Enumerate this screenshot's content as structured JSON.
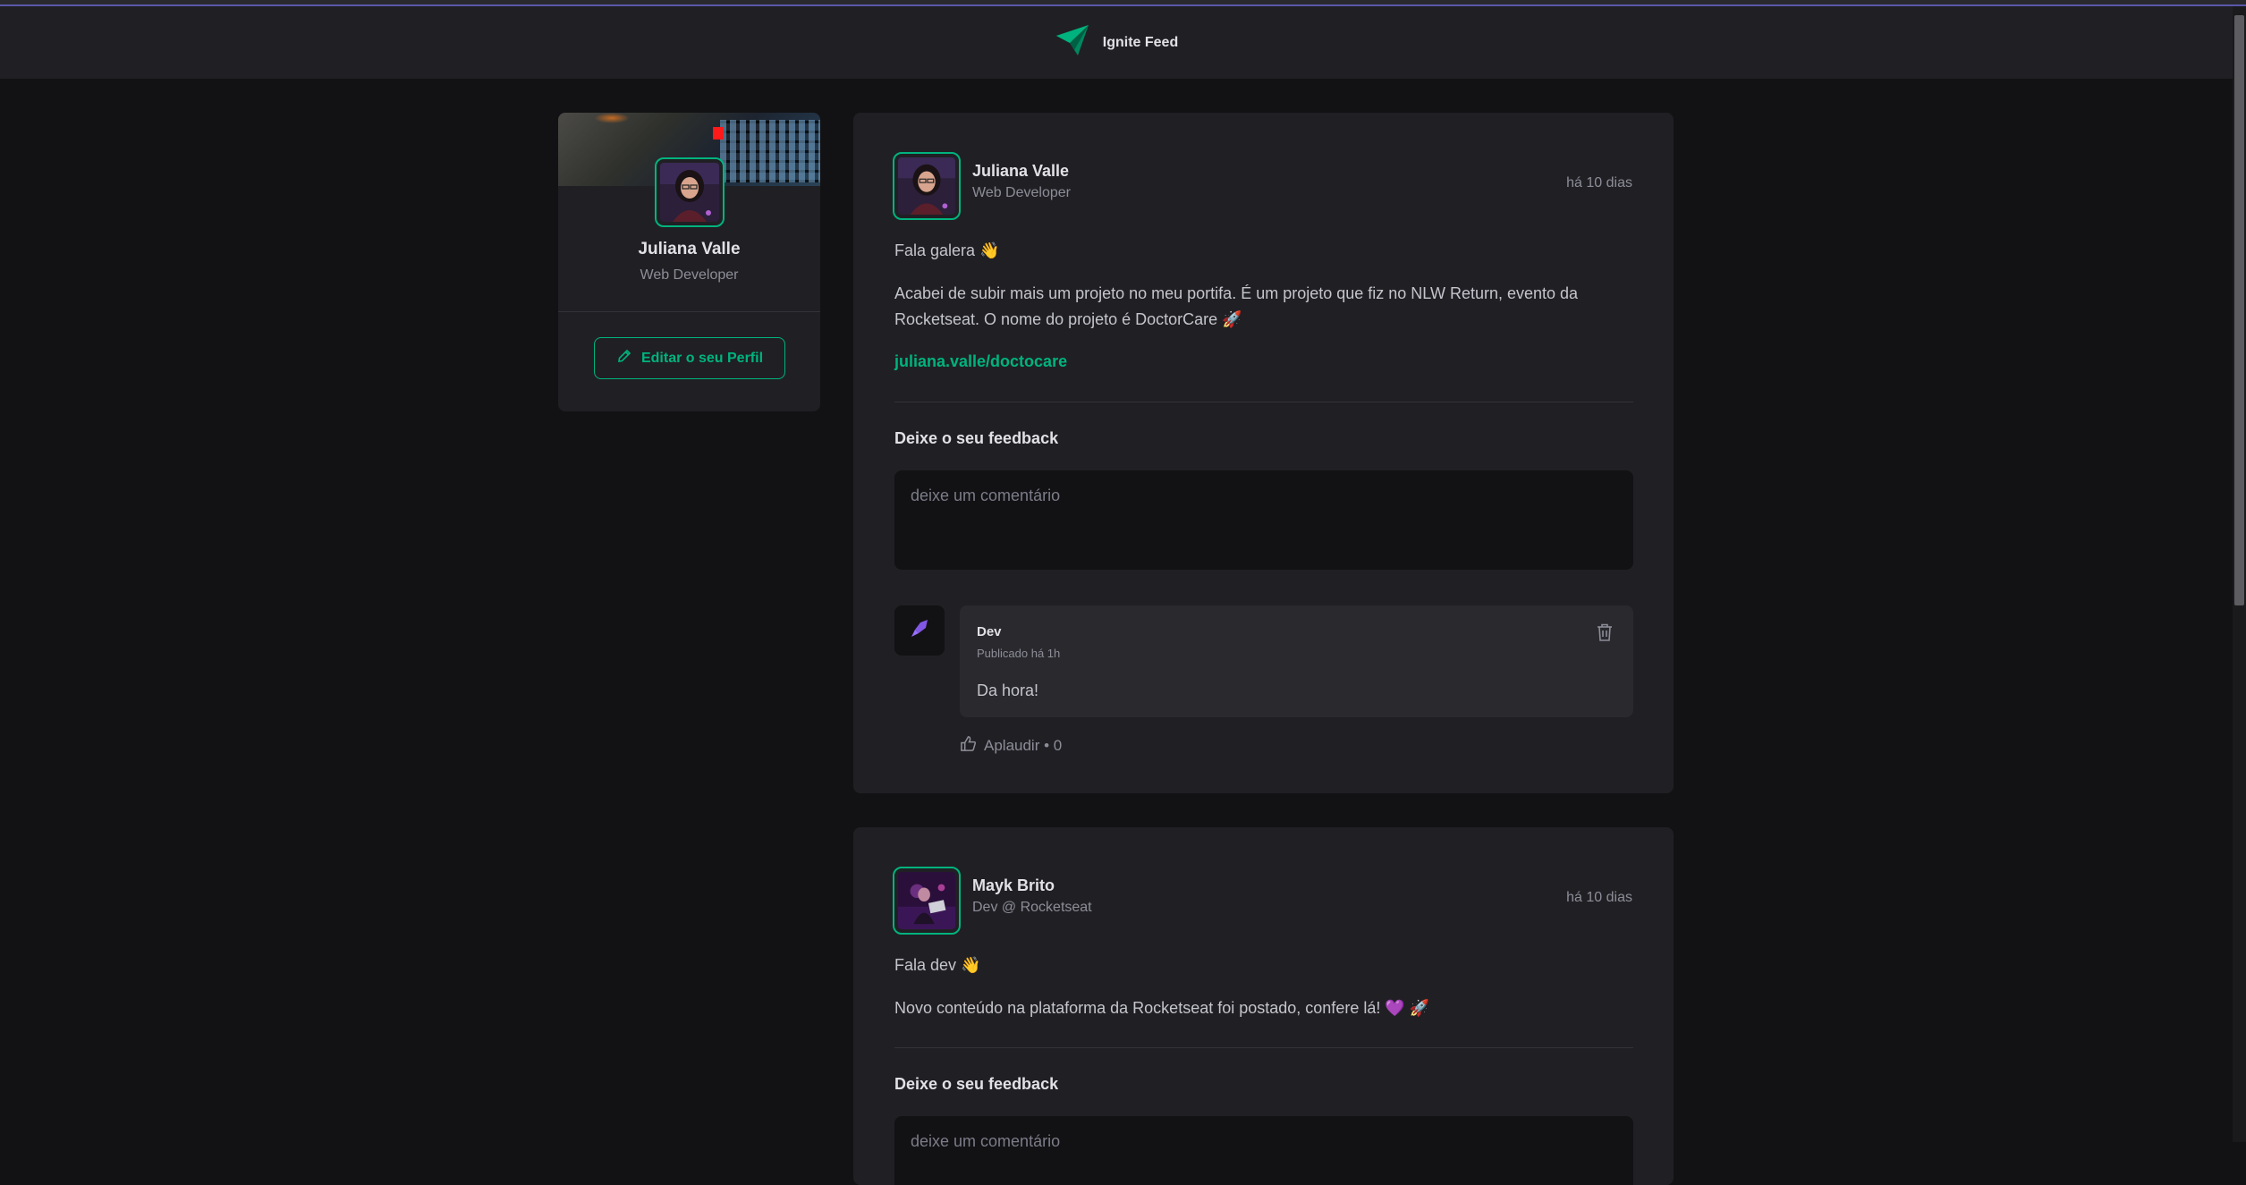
{
  "header": {
    "app_name": "Ignite Feed",
    "logo_icon": "paper-plane-logo-icon",
    "accent": "#00b37e"
  },
  "sidebar": {
    "name": "Juliana Valle",
    "role": "Web Developer",
    "edit_button": "Editar o seu Perfil",
    "edit_icon": "pencil-icon"
  },
  "posts": [
    {
      "author": {
        "name": "Juliana Valle",
        "role": "Web Developer"
      },
      "time": "há 10 dias",
      "greeting": "Fala galera 👋",
      "body": "Acabei de subir mais um projeto no meu portifa. É um projeto que fiz no NLW Return, evento da Rocketseat. O nome do projeto é DoctorCare 🚀",
      "link": "juliana.valle/doctocare",
      "feedback_title": "Deixe o seu feedback",
      "comment_placeholder": "deixe um comentário",
      "comments": [
        {
          "author": "Dev",
          "time": "Publicado há 1h",
          "text": "Da hora!",
          "applaud": "Aplaudir • 0"
        }
      ]
    },
    {
      "author": {
        "name": "Mayk Brito",
        "role": "Dev @ Rocketseat"
      },
      "time": "há 10 dias",
      "greeting": "Fala dev 👋",
      "body": "Novo conteúdo na plataforma da Rocketseat foi postado, confere lá! 💜 🚀",
      "feedback_title": "Deixe o seu feedback",
      "comment_placeholder": "deixe um comentário"
    }
  ]
}
